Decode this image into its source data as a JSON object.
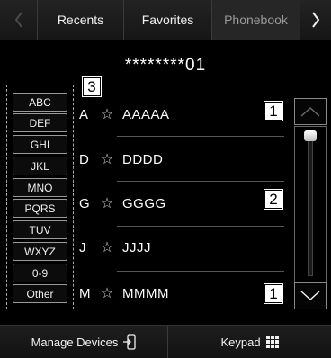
{
  "tabs": {
    "items": [
      {
        "label": "Recents"
      },
      {
        "label": "Favorites"
      },
      {
        "label": "Phonebook",
        "active": true
      }
    ]
  },
  "phone_number": "********01",
  "callouts": {
    "top_scroll": "1",
    "slider": "2",
    "bottom_scroll": "1",
    "index": "3"
  },
  "index_items": [
    "ABC",
    "DEF",
    "GHI",
    "JKL",
    "MNO",
    "PQRS",
    "TUV",
    "WXYZ",
    "0-9",
    "Other"
  ],
  "contacts": [
    {
      "letter": "A",
      "star": "☆",
      "name": "AAAAA"
    },
    {
      "letter": "D",
      "star": "☆",
      "name": "DDDD"
    },
    {
      "letter": "G",
      "star": "☆",
      "name": "GGGG"
    },
    {
      "letter": "J",
      "star": "☆",
      "name": "JJJJ"
    },
    {
      "letter": "M",
      "star": "☆",
      "name": "MMMM"
    }
  ],
  "scroll": {
    "position": 0
  },
  "bottom": {
    "manage_devices": "Manage Devices",
    "keypad": "Keypad"
  },
  "colors": {
    "background": "#000000",
    "text": "#ffffff",
    "inactive_tab_text": "#9a9a9a"
  }
}
